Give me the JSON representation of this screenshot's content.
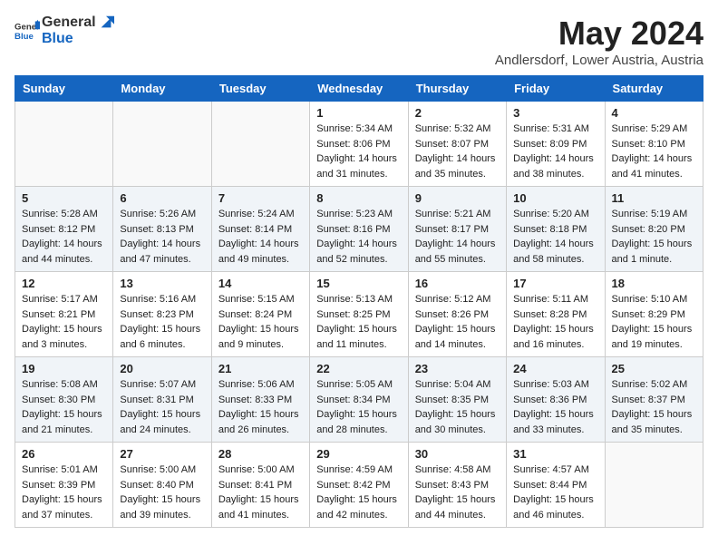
{
  "header": {
    "logo_general": "General",
    "logo_blue": "Blue",
    "month_title": "May 2024",
    "location": "Andlersdorf, Lower Austria, Austria"
  },
  "weekdays": [
    "Sunday",
    "Monday",
    "Tuesday",
    "Wednesday",
    "Thursday",
    "Friday",
    "Saturday"
  ],
  "weeks": [
    [
      {
        "day": "",
        "info": ""
      },
      {
        "day": "",
        "info": ""
      },
      {
        "day": "",
        "info": ""
      },
      {
        "day": "1",
        "info": "Sunrise: 5:34 AM\nSunset: 8:06 PM\nDaylight: 14 hours\nand 31 minutes."
      },
      {
        "day": "2",
        "info": "Sunrise: 5:32 AM\nSunset: 8:07 PM\nDaylight: 14 hours\nand 35 minutes."
      },
      {
        "day": "3",
        "info": "Sunrise: 5:31 AM\nSunset: 8:09 PM\nDaylight: 14 hours\nand 38 minutes."
      },
      {
        "day": "4",
        "info": "Sunrise: 5:29 AM\nSunset: 8:10 PM\nDaylight: 14 hours\nand 41 minutes."
      }
    ],
    [
      {
        "day": "5",
        "info": "Sunrise: 5:28 AM\nSunset: 8:12 PM\nDaylight: 14 hours\nand 44 minutes."
      },
      {
        "day": "6",
        "info": "Sunrise: 5:26 AM\nSunset: 8:13 PM\nDaylight: 14 hours\nand 47 minutes."
      },
      {
        "day": "7",
        "info": "Sunrise: 5:24 AM\nSunset: 8:14 PM\nDaylight: 14 hours\nand 49 minutes."
      },
      {
        "day": "8",
        "info": "Sunrise: 5:23 AM\nSunset: 8:16 PM\nDaylight: 14 hours\nand 52 minutes."
      },
      {
        "day": "9",
        "info": "Sunrise: 5:21 AM\nSunset: 8:17 PM\nDaylight: 14 hours\nand 55 minutes."
      },
      {
        "day": "10",
        "info": "Sunrise: 5:20 AM\nSunset: 8:18 PM\nDaylight: 14 hours\nand 58 minutes."
      },
      {
        "day": "11",
        "info": "Sunrise: 5:19 AM\nSunset: 8:20 PM\nDaylight: 15 hours\nand 1 minute."
      }
    ],
    [
      {
        "day": "12",
        "info": "Sunrise: 5:17 AM\nSunset: 8:21 PM\nDaylight: 15 hours\nand 3 minutes."
      },
      {
        "day": "13",
        "info": "Sunrise: 5:16 AM\nSunset: 8:23 PM\nDaylight: 15 hours\nand 6 minutes."
      },
      {
        "day": "14",
        "info": "Sunrise: 5:15 AM\nSunset: 8:24 PM\nDaylight: 15 hours\nand 9 minutes."
      },
      {
        "day": "15",
        "info": "Sunrise: 5:13 AM\nSunset: 8:25 PM\nDaylight: 15 hours\nand 11 minutes."
      },
      {
        "day": "16",
        "info": "Sunrise: 5:12 AM\nSunset: 8:26 PM\nDaylight: 15 hours\nand 14 minutes."
      },
      {
        "day": "17",
        "info": "Sunrise: 5:11 AM\nSunset: 8:28 PM\nDaylight: 15 hours\nand 16 minutes."
      },
      {
        "day": "18",
        "info": "Sunrise: 5:10 AM\nSunset: 8:29 PM\nDaylight: 15 hours\nand 19 minutes."
      }
    ],
    [
      {
        "day": "19",
        "info": "Sunrise: 5:08 AM\nSunset: 8:30 PM\nDaylight: 15 hours\nand 21 minutes."
      },
      {
        "day": "20",
        "info": "Sunrise: 5:07 AM\nSunset: 8:31 PM\nDaylight: 15 hours\nand 24 minutes."
      },
      {
        "day": "21",
        "info": "Sunrise: 5:06 AM\nSunset: 8:33 PM\nDaylight: 15 hours\nand 26 minutes."
      },
      {
        "day": "22",
        "info": "Sunrise: 5:05 AM\nSunset: 8:34 PM\nDaylight: 15 hours\nand 28 minutes."
      },
      {
        "day": "23",
        "info": "Sunrise: 5:04 AM\nSunset: 8:35 PM\nDaylight: 15 hours\nand 30 minutes."
      },
      {
        "day": "24",
        "info": "Sunrise: 5:03 AM\nSunset: 8:36 PM\nDaylight: 15 hours\nand 33 minutes."
      },
      {
        "day": "25",
        "info": "Sunrise: 5:02 AM\nSunset: 8:37 PM\nDaylight: 15 hours\nand 35 minutes."
      }
    ],
    [
      {
        "day": "26",
        "info": "Sunrise: 5:01 AM\nSunset: 8:39 PM\nDaylight: 15 hours\nand 37 minutes."
      },
      {
        "day": "27",
        "info": "Sunrise: 5:00 AM\nSunset: 8:40 PM\nDaylight: 15 hours\nand 39 minutes."
      },
      {
        "day": "28",
        "info": "Sunrise: 5:00 AM\nSunset: 8:41 PM\nDaylight: 15 hours\nand 41 minutes."
      },
      {
        "day": "29",
        "info": "Sunrise: 4:59 AM\nSunset: 8:42 PM\nDaylight: 15 hours\nand 42 minutes."
      },
      {
        "day": "30",
        "info": "Sunrise: 4:58 AM\nSunset: 8:43 PM\nDaylight: 15 hours\nand 44 minutes."
      },
      {
        "day": "31",
        "info": "Sunrise: 4:57 AM\nSunset: 8:44 PM\nDaylight: 15 hours\nand 46 minutes."
      },
      {
        "day": "",
        "info": ""
      }
    ]
  ]
}
